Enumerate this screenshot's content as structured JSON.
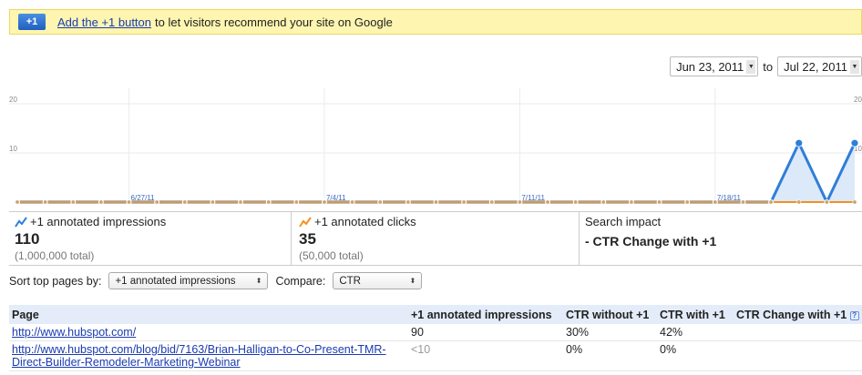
{
  "banner": {
    "badge_label": "+1",
    "link_text": "Add the +1 button",
    "rest_text": "to let visitors recommend your site on Google"
  },
  "date_range": {
    "start": "Jun 23, 2011",
    "separator": "to",
    "end": "Jul 22, 2011"
  },
  "chart_data": {
    "type": "line",
    "y_ticks_left": [
      "20",
      "10"
    ],
    "y_ticks_right": [
      "20",
      "10"
    ],
    "x_labels": [
      "6/27/11",
      "7/4/11",
      "7/11/11",
      "7/18/11"
    ],
    "ylim": [
      0,
      20
    ],
    "grid": true,
    "series": [
      {
        "color": "#2f7ed8",
        "values": [
          0,
          0,
          0,
          0,
          0,
          0,
          0,
          0,
          0,
          0,
          0,
          0,
          0,
          0,
          0,
          0,
          0,
          0,
          0,
          0,
          0,
          0,
          0,
          0,
          0,
          0,
          0,
          0,
          12,
          0,
          12
        ]
      },
      {
        "color": "#f4911e",
        "values": [
          0,
          0,
          0,
          0,
          0,
          0,
          0,
          0,
          0,
          0,
          0,
          0,
          0,
          0,
          0,
          0,
          0,
          0,
          0,
          0,
          0,
          0,
          0,
          0,
          0,
          0,
          0,
          0,
          0,
          0,
          0
        ]
      }
    ]
  },
  "metrics": [
    {
      "title": "+1 annotated impressions",
      "value": "110",
      "total": "(1,000,000 total)",
      "icon_color": "#2f7ed8"
    },
    {
      "title": "+1 annotated clicks",
      "value": "35",
      "total": "(50,000 total)",
      "icon_color": "#f4911e"
    },
    {
      "title": "Search impact",
      "impact": "- CTR Change with +1"
    }
  ],
  "sort": {
    "label": "Sort top pages by:",
    "selected": "+1 annotated impressions",
    "compare_label": "Compare:",
    "compare_selected": "CTR"
  },
  "table": {
    "headers": [
      "Page",
      "+1 annotated impressions",
      "CTR without +1",
      "CTR with +1",
      "CTR Change with +1"
    ],
    "help_icon": "?",
    "rows": [
      {
        "page": "http://www.hubspot.com/",
        "impressions": "90",
        "ctr_without": "30%",
        "ctr_with": "42%"
      },
      {
        "page_line1": "http://www.hubspot.com/blog/bid/7163/Brian-Halligan-to-Co-Present-TMR-",
        "page_line2": "Direct-Builder-Remodeler-Marketing-Webinar",
        "impressions": "<10",
        "ctr_without": "0%",
        "ctr_with": "0%"
      }
    ]
  }
}
